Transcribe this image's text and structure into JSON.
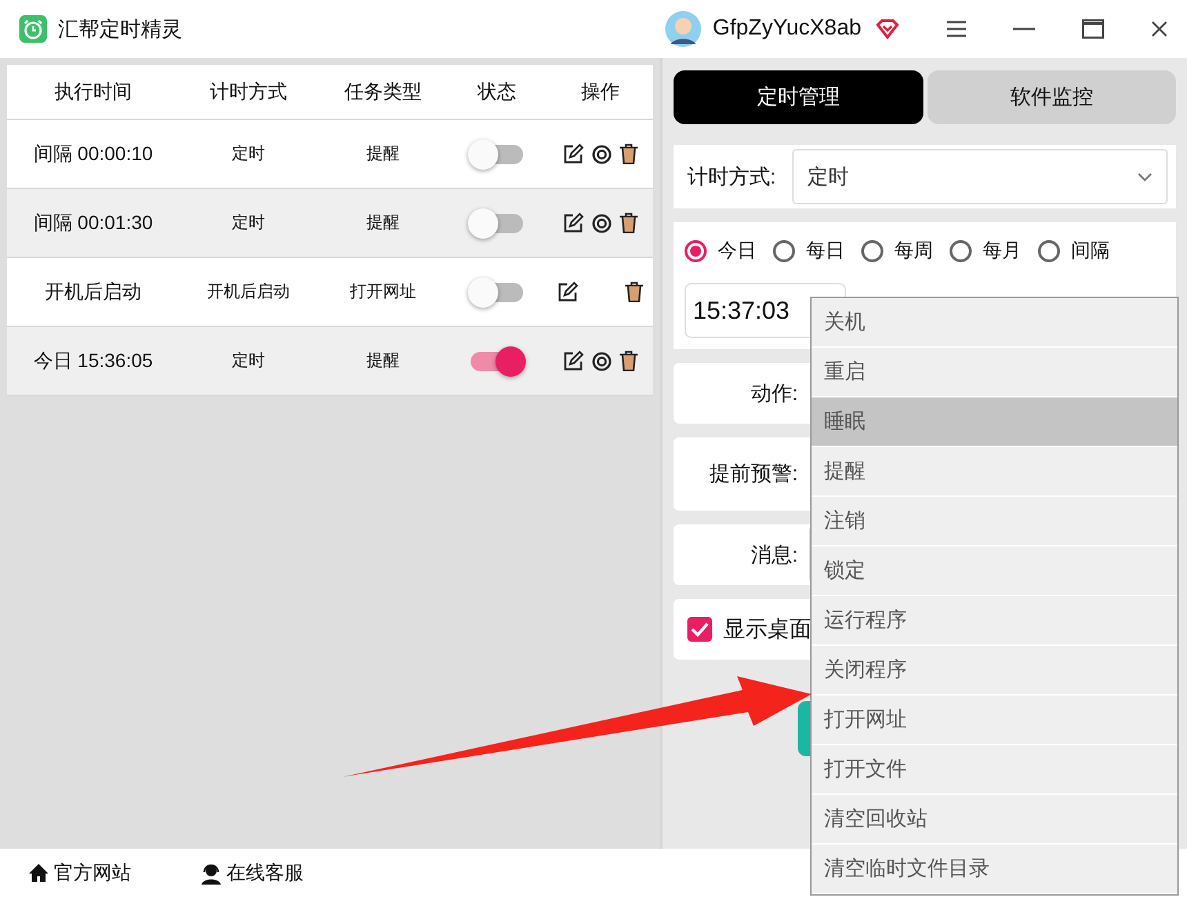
{
  "app": {
    "title": "汇帮定时精灵"
  },
  "user": {
    "name": "GfpZyYucX8ab"
  },
  "table": {
    "columns": [
      "执行时间",
      "计时方式",
      "任务类型",
      "状态",
      "操作"
    ],
    "rows": [
      {
        "time": "间隔 00:00:10",
        "mode": "定时",
        "task": "提醒",
        "on": false,
        "view_button": true
      },
      {
        "time": "间隔 00:01:30",
        "mode": "定时",
        "task": "提醒",
        "on": false,
        "view_button": true
      },
      {
        "time": "开机后启动",
        "mode": "开机后启动",
        "task": "打开网址",
        "on": false,
        "view_button": false
      },
      {
        "time": "今日 15:36:05",
        "mode": "定时",
        "task": "提醒",
        "on": true,
        "view_button": true
      }
    ]
  },
  "tabs": [
    {
      "label": "定时管理",
      "selected": true
    },
    {
      "label": "软件监控",
      "selected": false
    }
  ],
  "timing_mode": {
    "label": "计时方式:",
    "value": "定时"
  },
  "schedule": {
    "options": [
      {
        "label": "今日",
        "selected": true
      },
      {
        "label": "每日",
        "selected": false
      },
      {
        "label": "每周",
        "selected": false
      },
      {
        "label": "每月",
        "selected": false
      },
      {
        "label": "间隔",
        "selected": false
      }
    ],
    "time": "15:37:03"
  },
  "action": {
    "label": "动作:"
  },
  "warning": {
    "label": "提前预警:"
  },
  "message": {
    "label": "消息:"
  },
  "show_desktop": {
    "label": "显示桌面",
    "checked": true
  },
  "dropdown": {
    "items": [
      {
        "label": "关机",
        "selected": false
      },
      {
        "label": "重启",
        "selected": false
      },
      {
        "label": "睡眠",
        "selected": true
      },
      {
        "label": "提醒",
        "selected": false
      },
      {
        "label": "注销",
        "selected": false
      },
      {
        "label": "锁定",
        "selected": false
      },
      {
        "label": "运行程序",
        "selected": false
      },
      {
        "label": "关闭程序",
        "selected": false
      },
      {
        "label": "打开网址",
        "selected": false
      },
      {
        "label": "打开文件",
        "selected": false
      },
      {
        "label": "清空回收站",
        "selected": false
      },
      {
        "label": "清空临时文件目录",
        "selected": false
      }
    ]
  },
  "footer": [
    {
      "label": "官方网站",
      "kind": "home"
    },
    {
      "label": "在线客服",
      "kind": "support"
    }
  ]
}
